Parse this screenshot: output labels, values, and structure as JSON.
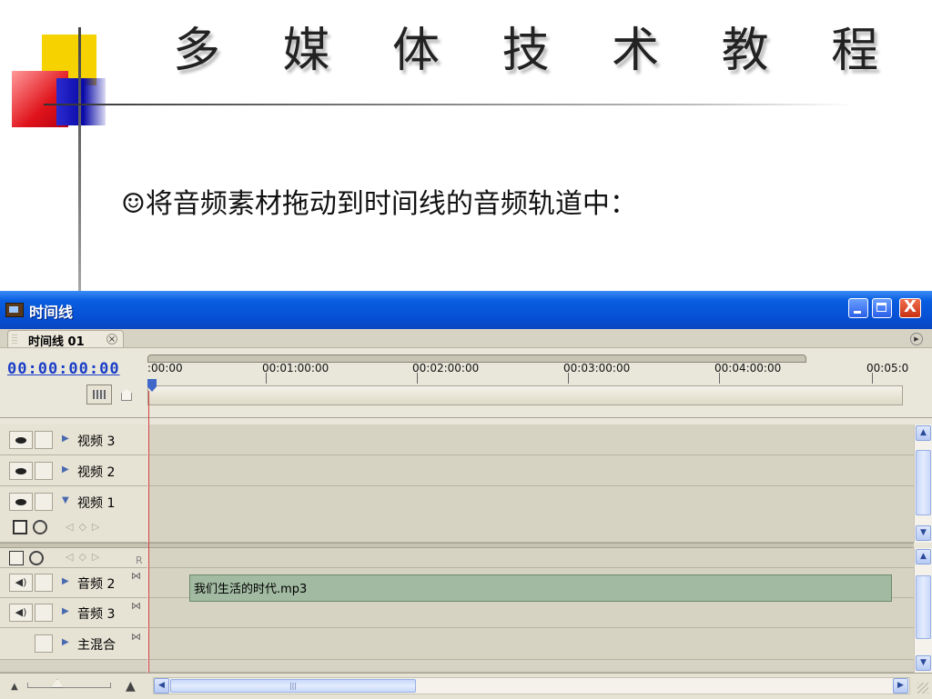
{
  "slide": {
    "title": "多 媒 体 技 术 教 程",
    "bullet": "☺将音频素材拖动到时间线的音频轨道中："
  },
  "window": {
    "title": "时间线",
    "buttons": {
      "close": "X"
    },
    "tab": {
      "label": "时间线 01",
      "close": "×"
    },
    "timecode": "00:00:00:00",
    "ruler_labels": [
      ":00:00",
      "00:01:00:00",
      "00:02:00:00",
      "00:03:00:00",
      "00:04:00:00",
      "00:05:0"
    ],
    "video_tracks": [
      {
        "name": "视频 3",
        "expanded": false
      },
      {
        "name": "视频 2",
        "expanded": false
      },
      {
        "name": "视频 1",
        "expanded": true
      }
    ],
    "audio_tracks": [
      {
        "name": "音频 2",
        "expanded": false
      },
      {
        "name": "音频 3",
        "expanded": false
      },
      {
        "name": "主混合",
        "expanded": false
      }
    ],
    "audio_header_marker": "R",
    "clip": {
      "label": "我们生活的时代.mp3",
      "track": "音频 2"
    },
    "colors": {
      "titlebar": "#0a5ee0",
      "clip": "#a2baa2",
      "timecode": "#1a3ec8",
      "playhead": "#d84040"
    }
  }
}
